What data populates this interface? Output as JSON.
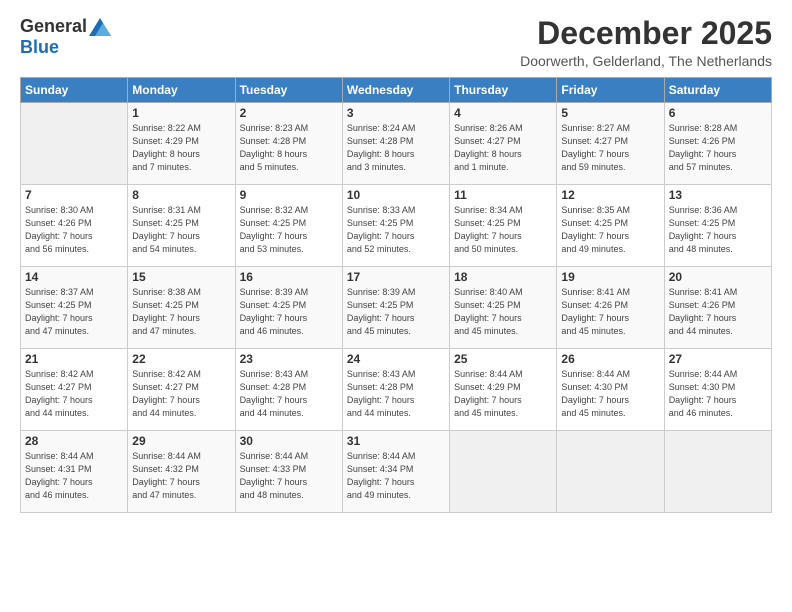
{
  "logo": {
    "general": "General",
    "blue": "Blue"
  },
  "header": {
    "month": "December 2025",
    "location": "Doorwerth, Gelderland, The Netherlands"
  },
  "days_of_week": [
    "Sunday",
    "Monday",
    "Tuesday",
    "Wednesday",
    "Thursday",
    "Friday",
    "Saturday"
  ],
  "weeks": [
    [
      {
        "day": "",
        "info": ""
      },
      {
        "day": "1",
        "info": "Sunrise: 8:22 AM\nSunset: 4:29 PM\nDaylight: 8 hours\nand 7 minutes."
      },
      {
        "day": "2",
        "info": "Sunrise: 8:23 AM\nSunset: 4:28 PM\nDaylight: 8 hours\nand 5 minutes."
      },
      {
        "day": "3",
        "info": "Sunrise: 8:24 AM\nSunset: 4:28 PM\nDaylight: 8 hours\nand 3 minutes."
      },
      {
        "day": "4",
        "info": "Sunrise: 8:26 AM\nSunset: 4:27 PM\nDaylight: 8 hours\nand 1 minute."
      },
      {
        "day": "5",
        "info": "Sunrise: 8:27 AM\nSunset: 4:27 PM\nDaylight: 7 hours\nand 59 minutes."
      },
      {
        "day": "6",
        "info": "Sunrise: 8:28 AM\nSunset: 4:26 PM\nDaylight: 7 hours\nand 57 minutes."
      }
    ],
    [
      {
        "day": "7",
        "info": "Sunrise: 8:30 AM\nSunset: 4:26 PM\nDaylight: 7 hours\nand 56 minutes."
      },
      {
        "day": "8",
        "info": "Sunrise: 8:31 AM\nSunset: 4:25 PM\nDaylight: 7 hours\nand 54 minutes."
      },
      {
        "day": "9",
        "info": "Sunrise: 8:32 AM\nSunset: 4:25 PM\nDaylight: 7 hours\nand 53 minutes."
      },
      {
        "day": "10",
        "info": "Sunrise: 8:33 AM\nSunset: 4:25 PM\nDaylight: 7 hours\nand 52 minutes."
      },
      {
        "day": "11",
        "info": "Sunrise: 8:34 AM\nSunset: 4:25 PM\nDaylight: 7 hours\nand 50 minutes."
      },
      {
        "day": "12",
        "info": "Sunrise: 8:35 AM\nSunset: 4:25 PM\nDaylight: 7 hours\nand 49 minutes."
      },
      {
        "day": "13",
        "info": "Sunrise: 8:36 AM\nSunset: 4:25 PM\nDaylight: 7 hours\nand 48 minutes."
      }
    ],
    [
      {
        "day": "14",
        "info": "Sunrise: 8:37 AM\nSunset: 4:25 PM\nDaylight: 7 hours\nand 47 minutes."
      },
      {
        "day": "15",
        "info": "Sunrise: 8:38 AM\nSunset: 4:25 PM\nDaylight: 7 hours\nand 47 minutes."
      },
      {
        "day": "16",
        "info": "Sunrise: 8:39 AM\nSunset: 4:25 PM\nDaylight: 7 hours\nand 46 minutes."
      },
      {
        "day": "17",
        "info": "Sunrise: 8:39 AM\nSunset: 4:25 PM\nDaylight: 7 hours\nand 45 minutes."
      },
      {
        "day": "18",
        "info": "Sunrise: 8:40 AM\nSunset: 4:25 PM\nDaylight: 7 hours\nand 45 minutes."
      },
      {
        "day": "19",
        "info": "Sunrise: 8:41 AM\nSunset: 4:26 PM\nDaylight: 7 hours\nand 45 minutes."
      },
      {
        "day": "20",
        "info": "Sunrise: 8:41 AM\nSunset: 4:26 PM\nDaylight: 7 hours\nand 44 minutes."
      }
    ],
    [
      {
        "day": "21",
        "info": "Sunrise: 8:42 AM\nSunset: 4:27 PM\nDaylight: 7 hours\nand 44 minutes."
      },
      {
        "day": "22",
        "info": "Sunrise: 8:42 AM\nSunset: 4:27 PM\nDaylight: 7 hours\nand 44 minutes."
      },
      {
        "day": "23",
        "info": "Sunrise: 8:43 AM\nSunset: 4:28 PM\nDaylight: 7 hours\nand 44 minutes."
      },
      {
        "day": "24",
        "info": "Sunrise: 8:43 AM\nSunset: 4:28 PM\nDaylight: 7 hours\nand 44 minutes."
      },
      {
        "day": "25",
        "info": "Sunrise: 8:44 AM\nSunset: 4:29 PM\nDaylight: 7 hours\nand 45 minutes."
      },
      {
        "day": "26",
        "info": "Sunrise: 8:44 AM\nSunset: 4:30 PM\nDaylight: 7 hours\nand 45 minutes."
      },
      {
        "day": "27",
        "info": "Sunrise: 8:44 AM\nSunset: 4:30 PM\nDaylight: 7 hours\nand 46 minutes."
      }
    ],
    [
      {
        "day": "28",
        "info": "Sunrise: 8:44 AM\nSunset: 4:31 PM\nDaylight: 7 hours\nand 46 minutes."
      },
      {
        "day": "29",
        "info": "Sunrise: 8:44 AM\nSunset: 4:32 PM\nDaylight: 7 hours\nand 47 minutes."
      },
      {
        "day": "30",
        "info": "Sunrise: 8:44 AM\nSunset: 4:33 PM\nDaylight: 7 hours\nand 48 minutes."
      },
      {
        "day": "31",
        "info": "Sunrise: 8:44 AM\nSunset: 4:34 PM\nDaylight: 7 hours\nand 49 minutes."
      },
      {
        "day": "",
        "info": ""
      },
      {
        "day": "",
        "info": ""
      },
      {
        "day": "",
        "info": ""
      }
    ]
  ]
}
